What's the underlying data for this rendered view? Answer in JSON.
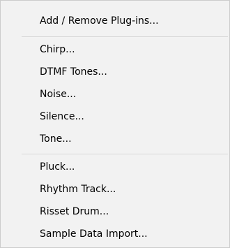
{
  "menu": {
    "groups": [
      {
        "items": [
          {
            "label": "Add / Remove Plug-ins..."
          }
        ]
      },
      {
        "items": [
          {
            "label": "Chirp..."
          },
          {
            "label": "DTMF Tones..."
          },
          {
            "label": "Noise..."
          },
          {
            "label": "Silence..."
          },
          {
            "label": "Tone..."
          }
        ]
      },
      {
        "items": [
          {
            "label": "Pluck..."
          },
          {
            "label": "Rhythm Track..."
          },
          {
            "label": "Risset Drum..."
          },
          {
            "label": "Sample Data Import..."
          }
        ]
      }
    ]
  }
}
